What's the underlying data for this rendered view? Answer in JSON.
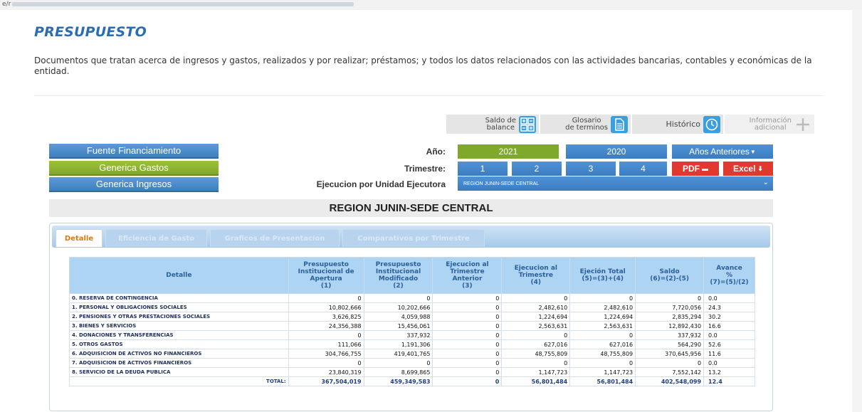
{
  "browser": {
    "url_fragment": "e/r"
  },
  "header": {
    "title": "PRESUPUESTO",
    "description": "Documentos que tratan acerca de ingresos y gastos, realizados y por realizar; préstamos; y todos los datos relacionados con las actividades bancarias, contables y económicas de la entidad."
  },
  "toolbar": {
    "saldo_line1": "Saldo de",
    "saldo_line2": "balance",
    "glosario_line1": "Glosario",
    "glosario_line2": "de terminos",
    "historico": "Histórico",
    "info_line1": "Información",
    "info_line2": "adicional"
  },
  "menu": {
    "items": [
      "Fuente Financiamiento",
      "Generica Gastos",
      "Generica Ingresos"
    ],
    "active": "Generica Gastos"
  },
  "filters": {
    "year_label": "Año:",
    "years": [
      "2021",
      "2020"
    ],
    "selected_year": "2021",
    "previous_years": "Años Anteriores",
    "quarter_label": "Trimestre:",
    "quarters": [
      "1",
      "2",
      "3",
      "4"
    ],
    "selected_quarter": "1",
    "pdf": "PDF",
    "excel": "Excel",
    "unit_label": "Ejecucion por Unidad Ejecutora",
    "unit_value": "REGION JUNIN-SEDE CENTRAL"
  },
  "region_title": "REGION JUNIN-SEDE CENTRAL",
  "tabs": [
    "Detalle",
    "Eficiencia de Gasto",
    "Graficos de Presentacion",
    "Comparativos por Trimestre"
  ],
  "active_tab": "Detalle",
  "table": {
    "headers": [
      {
        "l1": "Detalle"
      },
      {
        "l1": "Presupuesto",
        "l2": "Institucional de",
        "l3": "Apertura",
        "l4": "(1)"
      },
      {
        "l1": "Presupuesto",
        "l2": "Institucional",
        "l3": "Modificado",
        "l4": "(2)"
      },
      {
        "l1": "Ejecucion al",
        "l2": "Trimestre",
        "l3": "Anterior",
        "l4": "(3)"
      },
      {
        "l1": "Ejecucion al",
        "l2": "Trimestre",
        "l3": "(4)"
      },
      {
        "l1": "Ejeción Total",
        "l2": "(5)=(3)+(4)"
      },
      {
        "l1": "Saldo",
        "l2": "(6)=(2)-(5)"
      },
      {
        "l1": "Avance",
        "l2": "%",
        "l3": "(7)=(5)/(2)"
      }
    ],
    "rows": [
      [
        "0. RESERVA DE CONTINGENCIA",
        "0",
        "0",
        "0",
        "0",
        "0",
        "0",
        "0.0"
      ],
      [
        "1. PERSONAL Y OBLIGACIONES SOCIALES",
        "10,802,666",
        "10,202,666",
        "0",
        "2,482,610",
        "2,482,610",
        "7,720,056",
        "24.3"
      ],
      [
        "2. PENSIONES Y OTRAS PRESTACIONES SOCIALES",
        "3,626,825",
        "4,059,988",
        "0",
        "1,224,694",
        "1,224,694",
        "2,835,294",
        "30.2"
      ],
      [
        "3. BIENES Y SERVICIOS",
        "24,356,388",
        "15,456,061",
        "0",
        "2,563,631",
        "2,563,631",
        "12,892,430",
        "16.6"
      ],
      [
        "4. DONACIONES Y TRANSFERENCIAS",
        "0",
        "337,932",
        "0",
        "0",
        "0",
        "337,932",
        "0.0"
      ],
      [
        "5. OTROS GASTOS",
        "111,066",
        "1,191,306",
        "0",
        "627,016",
        "627,016",
        "564,290",
        "52.6"
      ],
      [
        "6. ADQUISICION DE ACTIVOS NO FINANCIEROS",
        "304,766,755",
        "419,401,765",
        "0",
        "48,755,809",
        "48,755,809",
        "370,645,956",
        "11.6"
      ],
      [
        "7. ADQUISICION DE ACTIVOS FINANCIEROS",
        "0",
        "0",
        "0",
        "0",
        "0",
        "0",
        "0.0"
      ],
      [
        "8. SERVICIO DE LA DEUDA PUBLICA",
        "23,840,319",
        "8,699,865",
        "0",
        "1,147,723",
        "1,147,723",
        "7,552,142",
        "13.2"
      ]
    ],
    "total": [
      "TOTAL:",
      "367,504,019",
      "459,349,583",
      "0",
      "56,801,484",
      "56,801,484",
      "402,548,099",
      "12.4"
    ]
  }
}
